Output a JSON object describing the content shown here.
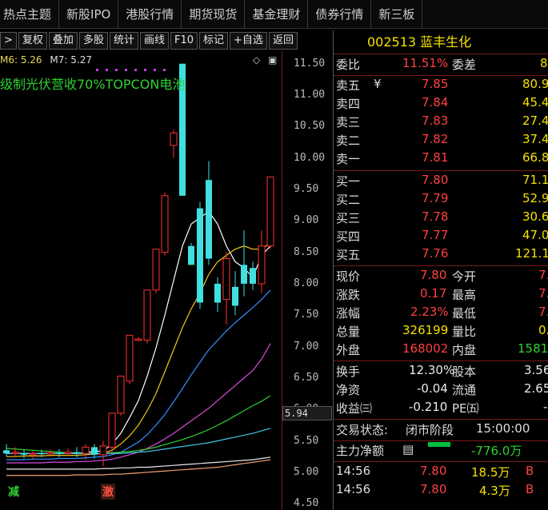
{
  "nav": {
    "items": [
      "热点主题",
      "新股IPO",
      "港股行情",
      "期货现货",
      "基金理财",
      "债券行情",
      "新三板"
    ]
  },
  "toolbar": {
    "buttons": [
      ">",
      "复权",
      "叠加",
      "多股",
      "统计",
      "画线",
      "F10",
      "标记",
      "+自选",
      "返回"
    ]
  },
  "chart": {
    "ma_legend": {
      "ma6": "M6: 5.26",
      "ma7": "M7: 5.27"
    },
    "concept_text": "级制光伏营收70%TOPCON电池",
    "price_ticks": [
      "11.50",
      "11.00",
      "10.50",
      "10.00",
      "9.50",
      "9.00",
      "8.50",
      "8.00",
      "7.50",
      "7.00",
      "6.50",
      "6.00",
      "5.50",
      "5.00",
      "4.50"
    ],
    "current_price_label": "5.94",
    "bottom_label_left": "减",
    "bottom_label_mid": "激",
    "icons": [
      "diamond-icon",
      "window-icon"
    ]
  },
  "chart_data": {
    "type": "candlestick",
    "ylim": [
      4.4,
      11.7
    ],
    "candles": [
      {
        "o": 5.35,
        "c": 5.3,
        "h": 5.45,
        "l": 5.25
      },
      {
        "o": 5.3,
        "c": 5.32,
        "h": 5.4,
        "l": 5.25
      },
      {
        "o": 5.3,
        "c": 5.28,
        "h": 5.36,
        "l": 5.22
      },
      {
        "o": 5.28,
        "c": 5.3,
        "h": 5.34,
        "l": 5.22
      },
      {
        "o": 5.3,
        "c": 5.29,
        "h": 5.36,
        "l": 5.24
      },
      {
        "o": 5.29,
        "c": 5.31,
        "h": 5.36,
        "l": 5.25
      },
      {
        "o": 5.31,
        "c": 5.3,
        "h": 5.37,
        "l": 5.24
      },
      {
        "o": 5.3,
        "c": 5.32,
        "h": 5.38,
        "l": 5.26
      },
      {
        "o": 5.32,
        "c": 5.3,
        "h": 5.4,
        "l": 5.24
      },
      {
        "o": 5.3,
        "c": 5.4,
        "h": 5.45,
        "l": 5.2
      },
      {
        "o": 5.4,
        "c": 5.28,
        "h": 5.45,
        "l": 5.22
      },
      {
        "o": 5.28,
        "c": 5.42,
        "h": 5.5,
        "l": 5.1
      },
      {
        "o": 5.4,
        "c": 5.94,
        "h": 5.94,
        "l": 5.3
      },
      {
        "o": 5.94,
        "c": 6.53,
        "h": 6.53,
        "l": 5.9
      },
      {
        "o": 6.45,
        "c": 7.18,
        "h": 7.18,
        "l": 6.4
      },
      {
        "o": 7.1,
        "c": 7.12,
        "h": 7.15,
        "l": 7.08
      },
      {
        "o": 7.1,
        "c": 7.9,
        "h": 7.9,
        "l": 7.05
      },
      {
        "o": 7.9,
        "c": 8.55,
        "h": 8.55,
        "l": 7.85
      },
      {
        "o": 8.5,
        "c": 9.4,
        "h": 9.45,
        "l": 8.45
      },
      {
        "o": 10.2,
        "c": 10.4,
        "h": 10.45,
        "l": 10.0
      },
      {
        "o": 11.5,
        "c": 9.4,
        "h": 11.5,
        "l": 9.4
      },
      {
        "o": 8.6,
        "c": 8.3,
        "h": 8.65,
        "l": 8.3
      },
      {
        "o": 9.2,
        "c": 7.7,
        "h": 9.3,
        "l": 7.6
      },
      {
        "o": 9.65,
        "c": 8.4,
        "h": 9.95,
        "l": 8.3
      },
      {
        "o": 8.0,
        "c": 7.7,
        "h": 8.1,
        "l": 7.55
      },
      {
        "o": 7.75,
        "c": 8.4,
        "h": 8.5,
        "l": 7.35
      },
      {
        "o": 7.95,
        "c": 7.65,
        "h": 8.2,
        "l": 7.5
      },
      {
        "o": 8.3,
        "c": 8.0,
        "h": 8.85,
        "l": 7.8
      },
      {
        "o": 8.25,
        "c": 8.0,
        "h": 8.35,
        "l": 7.9
      },
      {
        "o": 8.0,
        "c": 8.6,
        "h": 8.85,
        "l": 7.85
      },
      {
        "o": 8.6,
        "c": 9.7,
        "h": 9.7,
        "l": 8.55
      }
    ],
    "ma_lines": [
      {
        "color": "#ffffff",
        "values": [
          5.3,
          5.3,
          5.3,
          5.3,
          5.3,
          5.3,
          5.3,
          5.3,
          5.3,
          5.32,
          5.33,
          5.34,
          5.45,
          5.62,
          5.87,
          6.14,
          6.53,
          6.98,
          7.5,
          8.05,
          8.6,
          8.95,
          9.05,
          9.15,
          8.95,
          8.6,
          8.35,
          8.25,
          8.1,
          8.45,
          8.6
        ]
      },
      {
        "color": "#f5c518",
        "values": [
          5.25,
          5.25,
          5.26,
          5.26,
          5.26,
          5.27,
          5.27,
          5.27,
          5.27,
          5.28,
          5.29,
          5.3,
          5.35,
          5.45,
          5.58,
          5.75,
          5.98,
          6.25,
          6.6,
          6.95,
          7.3,
          7.6,
          7.85,
          8.15,
          8.35,
          8.45,
          8.55,
          8.6,
          8.55,
          8.55,
          8.65
        ]
      },
      {
        "color": "#3a8cff",
        "values": [
          5.2,
          5.2,
          5.2,
          5.21,
          5.21,
          5.21,
          5.22,
          5.22,
          5.22,
          5.23,
          5.24,
          5.25,
          5.28,
          5.32,
          5.4,
          5.48,
          5.6,
          5.75,
          5.92,
          6.12,
          6.33,
          6.55,
          6.75,
          6.95,
          7.1,
          7.25,
          7.38,
          7.5,
          7.62,
          7.75,
          7.9
        ]
      },
      {
        "color": "#d94adf",
        "values": [
          5.15,
          5.15,
          5.15,
          5.15,
          5.15,
          5.16,
          5.16,
          5.16,
          5.17,
          5.17,
          5.18,
          5.19,
          5.21,
          5.24,
          5.28,
          5.32,
          5.38,
          5.45,
          5.53,
          5.62,
          5.72,
          5.82,
          5.92,
          6.02,
          6.14,
          6.26,
          6.38,
          6.5,
          6.62,
          6.8,
          7.05
        ]
      },
      {
        "color": "#2fd22f",
        "values": [
          5.38,
          5.37,
          5.36,
          5.35,
          5.34,
          5.33,
          5.32,
          5.31,
          5.31,
          5.3,
          5.3,
          5.3,
          5.31,
          5.32,
          5.33,
          5.35,
          5.37,
          5.4,
          5.44,
          5.48,
          5.52,
          5.57,
          5.62,
          5.68,
          5.75,
          5.82,
          5.9,
          5.98,
          6.06,
          6.13,
          6.22
        ]
      },
      {
        "color": "#3ec8e8",
        "values": [
          5.3,
          5.3,
          5.3,
          5.3,
          5.3,
          5.3,
          5.3,
          5.3,
          5.3,
          5.3,
          5.3,
          5.3,
          5.3,
          5.3,
          5.31,
          5.32,
          5.33,
          5.35,
          5.37,
          5.39,
          5.41,
          5.43,
          5.45,
          5.47,
          5.5,
          5.53,
          5.56,
          5.59,
          5.62,
          5.66,
          5.7
        ]
      },
      {
        "color": "#eaeaea",
        "values": [
          5.05,
          5.05,
          5.05,
          5.05,
          5.05,
          5.05,
          5.05,
          5.05,
          5.05,
          5.05,
          5.05,
          5.06,
          5.06,
          5.07,
          5.07,
          5.08,
          5.08,
          5.09,
          5.1,
          5.11,
          5.12,
          5.13,
          5.14,
          5.15,
          5.16,
          5.17,
          5.18,
          5.19,
          5.2,
          5.22,
          5.24
        ]
      },
      {
        "color": "#f0a070",
        "values": [
          4.95,
          4.95,
          4.95,
          4.95,
          4.95,
          4.95,
          4.95,
          4.95,
          4.96,
          4.96,
          4.96,
          4.96,
          4.97,
          4.97,
          4.98,
          4.99,
          5.0,
          5.01,
          5.02,
          5.03,
          5.04,
          5.05,
          5.06,
          5.07,
          5.08,
          5.1,
          5.12,
          5.14,
          5.16,
          5.18,
          5.2
        ]
      }
    ]
  },
  "quote": {
    "code_name": "002513 蓝丰生化",
    "weibi_label": "委比",
    "weibi_val": "11.51%",
    "weicha_label": "委差",
    "weicha_val": "8",
    "asks": [
      {
        "label": "卖五",
        "mark": "¥",
        "price": "7.85",
        "vol": "80.9"
      },
      {
        "label": "卖四",
        "mark": "",
        "price": "7.84",
        "vol": "45.4"
      },
      {
        "label": "卖三",
        "mark": "",
        "price": "7.83",
        "vol": "27.4"
      },
      {
        "label": "卖二",
        "mark": "",
        "price": "7.82",
        "vol": "37.4"
      },
      {
        "label": "卖一",
        "mark": "",
        "price": "7.81",
        "vol": "66.8"
      }
    ],
    "bids": [
      {
        "label": "买一",
        "price": "7.80",
        "vol": "71.1"
      },
      {
        "label": "买二",
        "price": "7.79",
        "vol": "52.9"
      },
      {
        "label": "买三",
        "price": "7.78",
        "vol": "30.6"
      },
      {
        "label": "买四",
        "price": "7.77",
        "vol": "47.0"
      },
      {
        "label": "买五",
        "price": "7.76",
        "vol": "121.1"
      }
    ],
    "stats": [
      {
        "l1": "现价",
        "v1": "7.80",
        "l2": "今开",
        "v2": "7."
      },
      {
        "l1": "涨跌",
        "v1": "0.17",
        "l2": "最高",
        "v2": "7."
      },
      {
        "l1": "涨幅",
        "v1": "2.23%",
        "l2": "最低",
        "v2": "7."
      },
      {
        "l1": "总量",
        "v1": "326199",
        "l2": "量比",
        "v2": "0."
      },
      {
        "l1": "外盘",
        "v1": "168002",
        "l2": "内盘",
        "v2": "1581"
      }
    ],
    "fund": [
      {
        "l1": "换手",
        "v1": "12.30%",
        "l2": "股本",
        "v2": "3.56"
      },
      {
        "l1": "净资",
        "v1": "-0.04",
        "l2": "流通",
        "v2": "2.65"
      },
      {
        "l1": "收益㈢",
        "v1": "-0.210",
        "l2": "PE㈤",
        "v2": "-"
      }
    ],
    "trade_status_label": "交易状态:",
    "trade_status_value": "闭市阶段",
    "trade_status_time": "15:00:00",
    "main_net_label": "主力净额",
    "main_net_value": "-776.0万",
    "ticks": [
      {
        "time": "14:56",
        "price": "7.80",
        "vol": "18.5万",
        "side": "B"
      },
      {
        "time": "14:56",
        "price": "7.80",
        "vol": "4.3万",
        "side": "B"
      }
    ]
  }
}
